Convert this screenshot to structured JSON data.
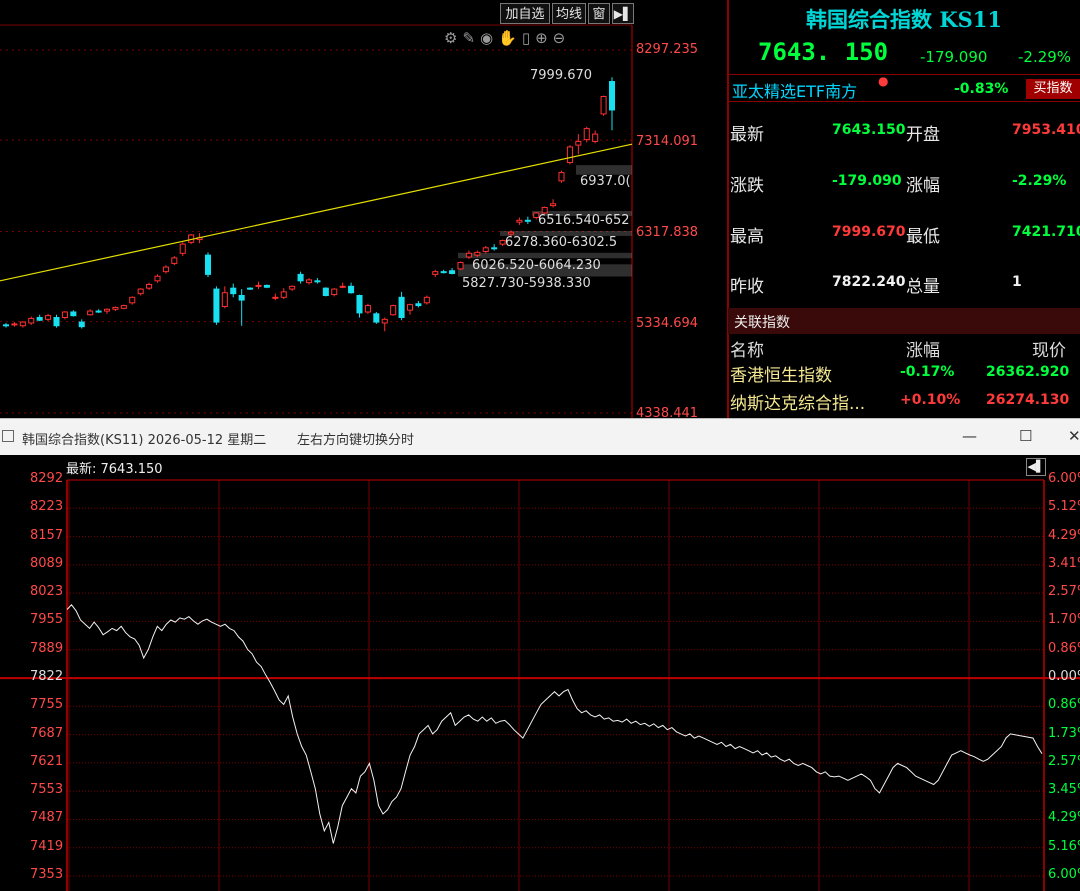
{
  "toolbar": {
    "add_watch": "加自选",
    "avg_line": "均线",
    "window": "窗",
    "collapse_icon": "collapse-right-icon"
  },
  "chart_tools": [
    "settings-icon",
    "pen-icon",
    "eye-icon",
    "hand-icon",
    "lock-icon",
    "zoom-in-icon",
    "zoom-out-icon"
  ],
  "k_y_axis": [
    "8297.235",
    "7314.091",
    "6317.838",
    "5334.694",
    "4338.441"
  ],
  "k_annotations": {
    "high": "7999.670",
    "gap1": "6937.0(",
    "gap2": "6516.540-652",
    "gap3": "6278.360-6302.5",
    "gap4": "6026.520-6064.230",
    "gap5": "5827.730-5938.330"
  },
  "chart_data": [
    {
      "type": "candlestick",
      "title": "",
      "ylim": [
        4338.441,
        8297.235
      ],
      "y_ticks": [
        8297.235,
        7314.091,
        6317.838,
        5334.694,
        4338.441
      ],
      "trend_line": "yellow rising line",
      "candles": [
        {
          "o": 5300,
          "h": 5320,
          "l": 5270,
          "c": 5295
        },
        {
          "o": 5300,
          "h": 5330,
          "l": 5280,
          "c": 5310
        },
        {
          "o": 5290,
          "h": 5340,
          "l": 5270,
          "c": 5330
        },
        {
          "o": 5320,
          "h": 5390,
          "l": 5300,
          "c": 5370
        },
        {
          "o": 5380,
          "h": 5410,
          "l": 5340,
          "c": 5350
        },
        {
          "o": 5360,
          "h": 5420,
          "l": 5340,
          "c": 5400
        },
        {
          "o": 5380,
          "h": 5410,
          "l": 5270,
          "c": 5290
        },
        {
          "o": 5380,
          "h": 5450,
          "l": 5360,
          "c": 5440
        },
        {
          "o": 5440,
          "h": 5460,
          "l": 5390,
          "c": 5400
        },
        {
          "o": 5330,
          "h": 5360,
          "l": 5260,
          "c": 5280
        },
        {
          "o": 5410,
          "h": 5470,
          "l": 5400,
          "c": 5450
        },
        {
          "o": 5450,
          "h": 5470,
          "l": 5430,
          "c": 5440
        },
        {
          "o": 5450,
          "h": 5480,
          "l": 5420,
          "c": 5470
        },
        {
          "o": 5470,
          "h": 5500,
          "l": 5450,
          "c": 5490
        },
        {
          "o": 5480,
          "h": 5520,
          "l": 5470,
          "c": 5510
        },
        {
          "o": 5540,
          "h": 5610,
          "l": 5520,
          "c": 5600
        },
        {
          "o": 5640,
          "h": 5700,
          "l": 5620,
          "c": 5690
        },
        {
          "o": 5700,
          "h": 5760,
          "l": 5680,
          "c": 5740
        },
        {
          "o": 5780,
          "h": 5850,
          "l": 5760,
          "c": 5830
        },
        {
          "o": 5880,
          "h": 5950,
          "l": 5860,
          "c": 5930
        },
        {
          "o": 5970,
          "h": 6050,
          "l": 5950,
          "c": 6030
        },
        {
          "o": 6080,
          "h": 6200,
          "l": 6050,
          "c": 6180
        },
        {
          "o": 6200,
          "h": 6290,
          "l": 6180,
          "c": 6280
        },
        {
          "o": 6230,
          "h": 6300,
          "l": 6190,
          "c": 6250
        },
        {
          "o": 6060,
          "h": 6090,
          "l": 5820,
          "c": 5850
        },
        {
          "o": 5690,
          "h": 5720,
          "l": 5300,
          "c": 5330
        },
        {
          "o": 5500,
          "h": 5720,
          "l": 5480,
          "c": 5650
        },
        {
          "o": 5700,
          "h": 5750,
          "l": 5600,
          "c": 5640
        },
        {
          "o": 5620,
          "h": 5690,
          "l": 5290,
          "c": 5570
        },
        {
          "o": 5700,
          "h": 5710,
          "l": 5680,
          "c": 5690
        },
        {
          "o": 5720,
          "h": 5770,
          "l": 5690,
          "c": 5730
        },
        {
          "o": 5730,
          "h": 5740,
          "l": 5700,
          "c": 5710
        },
        {
          "o": 5590,
          "h": 5640,
          "l": 5570,
          "c": 5600
        },
        {
          "o": 5600,
          "h": 5700,
          "l": 5580,
          "c": 5660
        },
        {
          "o": 5690,
          "h": 5730,
          "l": 5670,
          "c": 5720
        },
        {
          "o": 5850,
          "h": 5880,
          "l": 5750,
          "c": 5780
        },
        {
          "o": 5760,
          "h": 5810,
          "l": 5740,
          "c": 5790
        },
        {
          "o": 5780,
          "h": 5810,
          "l": 5750,
          "c": 5770
        },
        {
          "o": 5700,
          "h": 5710,
          "l": 5610,
          "c": 5620
        },
        {
          "o": 5630,
          "h": 5700,
          "l": 5610,
          "c": 5690
        },
        {
          "o": 5720,
          "h": 5760,
          "l": 5700,
          "c": 5720
        },
        {
          "o": 5720,
          "h": 5760,
          "l": 5640,
          "c": 5650
        },
        {
          "o": 5620,
          "h": 5630,
          "l": 5380,
          "c": 5430
        },
        {
          "o": 5440,
          "h": 5530,
          "l": 5420,
          "c": 5510
        },
        {
          "o": 5420,
          "h": 5440,
          "l": 5310,
          "c": 5330
        },
        {
          "o": 5320,
          "h": 5380,
          "l": 5230,
          "c": 5360
        },
        {
          "o": 5410,
          "h": 5520,
          "l": 5400,
          "c": 5510
        },
        {
          "o": 5600,
          "h": 5660,
          "l": 5350,
          "c": 5380
        },
        {
          "o": 5460,
          "h": 5530,
          "l": 5410,
          "c": 5520
        },
        {
          "o": 5530,
          "h": 5560,
          "l": 5490,
          "c": 5510
        },
        {
          "o": 5540,
          "h": 5620,
          "l": 5520,
          "c": 5600
        },
        {
          "o": 5850,
          "h": 5900,
          "l": 5820,
          "c": 5880
        },
        {
          "o": 5880,
          "h": 5900,
          "l": 5860,
          "c": 5870
        },
        {
          "o": 5890,
          "h": 5920,
          "l": 5850,
          "c": 5860
        },
        {
          "o": 5910,
          "h": 5990,
          "l": 5900,
          "c": 5980
        },
        {
          "o": 6040,
          "h": 6110,
          "l": 6020,
          "c": 6080
        },
        {
          "o": 6060,
          "h": 6110,
          "l": 6040,
          "c": 6090
        },
        {
          "o": 6100,
          "h": 6160,
          "l": 6080,
          "c": 6140
        },
        {
          "o": 6140,
          "h": 6180,
          "l": 6110,
          "c": 6130
        },
        {
          "o": 6180,
          "h": 6230,
          "l": 6160,
          "c": 6220
        },
        {
          "o": 6290,
          "h": 6330,
          "l": 6270,
          "c": 6310
        },
        {
          "o": 6420,
          "h": 6470,
          "l": 6390,
          "c": 6440
        },
        {
          "o": 6440,
          "h": 6480,
          "l": 6400,
          "c": 6430
        },
        {
          "o": 6470,
          "h": 6530,
          "l": 6450,
          "c": 6520
        },
        {
          "o": 6520,
          "h": 6590,
          "l": 6510,
          "c": 6580
        },
        {
          "o": 6600,
          "h": 6670,
          "l": 6580,
          "c": 6620
        },
        {
          "o": 6870,
          "h": 6980,
          "l": 6850,
          "c": 6960
        },
        {
          "o": 7070,
          "h": 7260,
          "l": 7050,
          "c": 7240
        },
        {
          "o": 7260,
          "h": 7380,
          "l": 7160,
          "c": 7300
        },
        {
          "o": 7320,
          "h": 7460,
          "l": 7290,
          "c": 7440
        },
        {
          "o": 7300,
          "h": 7420,
          "l": 7280,
          "c": 7380
        },
        {
          "o": 7600,
          "h": 7800,
          "l": 7580,
          "c": 7790
        },
        {
          "o": 7953.41,
          "h": 7999.67,
          "l": 7421.71,
          "c": 7643.15
        }
      ]
    },
    {
      "type": "line",
      "title": "",
      "ylim": [
        7353,
        8292
      ],
      "y_ticks": [
        8292,
        8223,
        8157,
        8089,
        8023,
        7955,
        7889,
        7822,
        7755,
        7687,
        7621,
        7553,
        7487,
        7419,
        7353
      ],
      "right_ticks": [
        "6.00%",
        "5.12%",
        "4.29%",
        "3.41%",
        "2.57%",
        "1.70%",
        "0.86%",
        "0.00%",
        "0.86%",
        "1.73%",
        "2.57%",
        "3.45%",
        "4.29%",
        "5.16%",
        "6.00%"
      ],
      "reference": 7822.24,
      "values": [
        7985,
        7996,
        7982,
        7960,
        7950,
        7940,
        7955,
        7942,
        7925,
        7932,
        7940,
        7935,
        7945,
        7930,
        7920,
        7915,
        7900,
        7870,
        7890,
        7920,
        7945,
        7935,
        7950,
        7960,
        7955,
        7965,
        7962,
        7968,
        7958,
        7950,
        7958,
        7962,
        7955,
        7950,
        7945,
        7950,
        7940,
        7935,
        7920,
        7910,
        7890,
        7880,
        7860,
        7850,
        7830,
        7812,
        7792,
        7770,
        7760,
        7780,
        7730,
        7690,
        7660,
        7640,
        7600,
        7560,
        7500,
        7460,
        7480,
        7430,
        7470,
        7520,
        7540,
        7560,
        7550,
        7590,
        7600,
        7620,
        7580,
        7520,
        7500,
        7510,
        7530,
        7540,
        7560,
        7600,
        7640,
        7660,
        7690,
        7700,
        7710,
        7690,
        7700,
        7720,
        7730,
        7740,
        7710,
        7720,
        7730,
        7735,
        7725,
        7720,
        7730,
        7720,
        7728,
        7715,
        7720,
        7722,
        7712,
        7700,
        7690,
        7680,
        7700,
        7720,
        7740,
        7760,
        7770,
        7780,
        7790,
        7780,
        7790,
        7795,
        7770,
        7750,
        7740,
        7745,
        7735,
        7730,
        7735,
        7725,
        7728,
        7720,
        7722,
        7718,
        7725,
        7715,
        7720,
        7712,
        7715,
        7708,
        7714,
        7705,
        7710,
        7700,
        7705,
        7695,
        7690,
        7685,
        7690,
        7680,
        7685,
        7680,
        7675,
        7670,
        7665,
        7670,
        7660,
        7665,
        7655,
        7660,
        7655,
        7650,
        7645,
        7650,
        7640,
        7645,
        7635,
        7638,
        7630,
        7625,
        7630,
        7620,
        7615,
        7620,
        7615,
        7610,
        7600,
        7595,
        7600,
        7590,
        7588,
        7590,
        7585,
        7580,
        7585,
        7590,
        7595,
        7588,
        7580,
        7560,
        7550,
        7570,
        7590,
        7610,
        7620,
        7615,
        7610,
        7600,
        7590,
        7585,
        7580,
        7575,
        7570,
        7580,
        7600,
        7620,
        7640,
        7645,
        7650,
        7645,
        7640,
        7636,
        7630,
        7625,
        7630,
        7640,
        7650,
        7660,
        7680,
        7690,
        7688,
        7686,
        7684,
        7682,
        7680,
        7660,
        7643
      ]
    }
  ],
  "quote": {
    "title": "韩国综合指数 KS11",
    "price": "7643. 150",
    "change": "-179.090",
    "change_pct": "-2.29%",
    "etf_name": "亚太精选ETF南方",
    "etf_change": "-0.83%",
    "buy_button": "买指数",
    "rows": [
      {
        "l1": "最新",
        "v1": "7643.150",
        "l2": "开盘",
        "v2": "7953.410"
      },
      {
        "l1": "涨跌",
        "v1": "-179.090",
        "l2": "涨幅",
        "v2": "-2.29%"
      },
      {
        "l1": "最高",
        "v1": "7999.670",
        "l2": "最低",
        "v2": "7421.710"
      },
      {
        "l1": "昨收",
        "v1": "7822.240",
        "l2": "总量",
        "v2": "1"
      }
    ],
    "related_title": "关联指数",
    "related_headers": [
      "名称",
      "涨幅",
      "现价"
    ],
    "related": [
      {
        "name": "香港恒生指数",
        "pct": "-0.17%",
        "price": "26362.920"
      },
      {
        "name": "纳斯达克综合指...",
        "pct": "+0.10%",
        "price": "26274.130"
      }
    ]
  },
  "window": {
    "title": "韩国综合指数(KS11) 2026-05-12 星期二",
    "hint": "左右方向键切换分时",
    "minimize": "—",
    "maximize": "☐",
    "close": "✕"
  },
  "intraday": {
    "latest_label": "最新: 7643.150"
  },
  "colors": {
    "up": "#ff3030",
    "down": "#18e0f0",
    "axis": "#c00000",
    "trend": "#e6e000"
  }
}
